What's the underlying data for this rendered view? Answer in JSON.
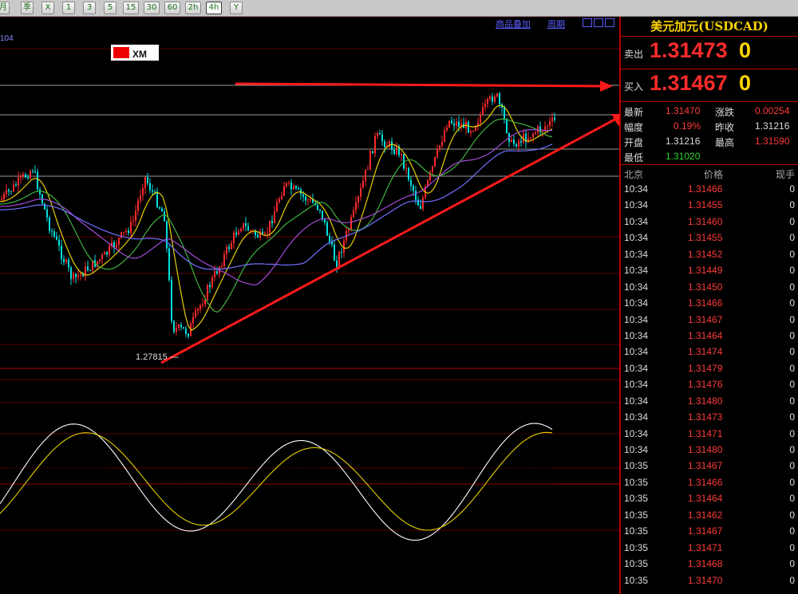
{
  "toolbar": {
    "buttons": [
      "月",
      "季",
      "X",
      "1",
      "3",
      "5",
      "15",
      "30",
      "60",
      "2h",
      "4h",
      "Y"
    ]
  },
  "chart": {
    "links": {
      "overlay": "商品叠加",
      "period": "周期"
    },
    "corner_value": "104",
    "logo_text": "XM",
    "low_label": "1.27815",
    "colors": {
      "up": "#ff2a2a",
      "down": "#00e0e0",
      "ma_yellow": "#e6d000",
      "ma_green": "#3fb43f",
      "ma_purple": "#a34bd6",
      "ma_blue": "#7070ff",
      "dif": "#ffffff",
      "dea": "#e6d000",
      "annotation": "#ff1a1a"
    }
  },
  "quote": {
    "title": "美元加元(USDCAD)",
    "sell_label": "卖出",
    "sell_price": "1.31473",
    "sell_vol": "0",
    "buy_label": "买入",
    "buy_price": "1.31467",
    "buy_vol": "0",
    "stats": {
      "latest_label": "最新",
      "latest": "1.31470",
      "change_label": "涨跌",
      "change": "0.00254",
      "pct_label": "幅度",
      "pct": "0.19%",
      "prev_label": "昨收",
      "prev": "1.31216",
      "open_label": "开盘",
      "open": "1.31216",
      "high_label": "最高",
      "high": "1.31590",
      "low_label": "最低",
      "low": "1.31020"
    },
    "ticks_header": {
      "time": "北京",
      "price": "价格",
      "vol": "现手"
    },
    "ticks": [
      [
        "10:34",
        "1.31466",
        "0"
      ],
      [
        "10:34",
        "1.31455",
        "0"
      ],
      [
        "10:34",
        "1.31460",
        "0"
      ],
      [
        "10:34",
        "1.31455",
        "0"
      ],
      [
        "10:34",
        "1.31452",
        "0"
      ],
      [
        "10:34",
        "1.31449",
        "0"
      ],
      [
        "10:34",
        "1.31450",
        "0"
      ],
      [
        "10:34",
        "1.31466",
        "0"
      ],
      [
        "10:34",
        "1.31467",
        "0"
      ],
      [
        "10:34",
        "1.31464",
        "0"
      ],
      [
        "10:34",
        "1.31474",
        "0"
      ],
      [
        "10:34",
        "1.31479",
        "0"
      ],
      [
        "10:34",
        "1.31476",
        "0"
      ],
      [
        "10:34",
        "1.31480",
        "0"
      ],
      [
        "10:34",
        "1.31473",
        "0"
      ],
      [
        "10:34",
        "1.31471",
        "0"
      ],
      [
        "10:34",
        "1.31480",
        "0"
      ],
      [
        "10:35",
        "1.31467",
        "0"
      ],
      [
        "10:35",
        "1.31466",
        "0"
      ],
      [
        "10:35",
        "1.31464",
        "0"
      ],
      [
        "10:35",
        "1.31462",
        "0"
      ],
      [
        "10:35",
        "1.31467",
        "0"
      ],
      [
        "10:35",
        "1.31471",
        "0"
      ],
      [
        "10:35",
        "1.31468",
        "0"
      ],
      [
        "10:35",
        "1.31470",
        "0"
      ]
    ]
  }
}
